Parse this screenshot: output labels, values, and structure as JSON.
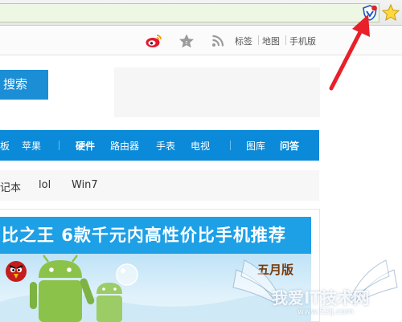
{
  "toolbar": {
    "weibo_icon": "weibo-icon",
    "favorite_icon": "star-outline-icon",
    "rss_icon": "rss-icon",
    "links": [
      "标签",
      "地图",
      "手机版"
    ]
  },
  "search": {
    "button_label": "搜索"
  },
  "nav": {
    "items": [
      "板",
      "苹果",
      "硬件",
      "路由器",
      "手表",
      "电视",
      "图库",
      "问答"
    ]
  },
  "tags": {
    "items": [
      "记本",
      "lol",
      "Win7"
    ]
  },
  "banner": {
    "title": "比之王  6款千元内高性价比手机推荐",
    "month_label": "五月版"
  },
  "watermark": {
    "text": "我爱IT技术网",
    "url": "www.52ij.com"
  },
  "colors": {
    "nav_blue": "#0a8ad8",
    "banner_blue": "#1ea0e6",
    "arrow_red": "#e8202a"
  }
}
